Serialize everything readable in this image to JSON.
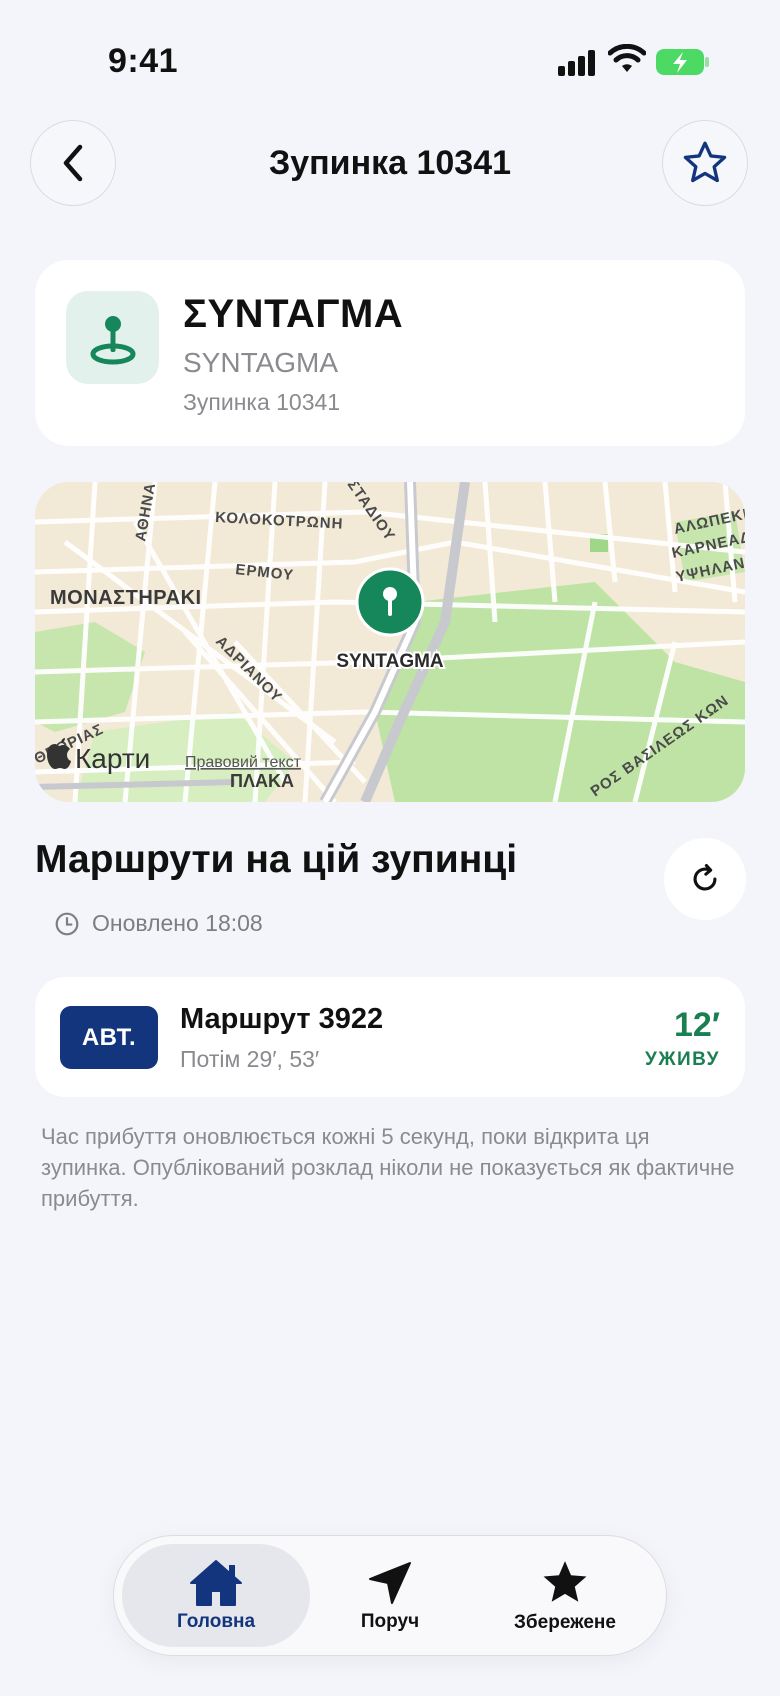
{
  "status_bar": {
    "time": "9:41"
  },
  "header": {
    "title": "Зупинка 10341"
  },
  "stop": {
    "name": "ΣΥΝΤΑΓΜΑ",
    "name_latin": "SYNTAGMA",
    "code_label": "Зупинка 10341"
  },
  "map": {
    "labels": {
      "kolokotroni": "ΚΟΛΟΚΟΤΡΩΝΗ",
      "ermou": "ΕΡΜΟΥ",
      "monastiraki": "ΜΟΝΑΣΤΗΡΑΚΙ",
      "adrianou": "ΑΔΡΙΑΝΟΥ",
      "athinas": "ΑΘΗΝΑ",
      "stadiou": "ΣΤΑΔΙΟΥ",
      "syntagma": "SYNTAGMA",
      "theorias": "ΘΕΩΡΙΑΣ",
      "plaka": "ΠΛΑΚΑ",
      "alopekis": "ΑΛΩΠΕΚΗ",
      "karneadou": "ΚΑΡΝΕΑΔ",
      "ypsilantou": "ΥΨΗΛΑΝ",
      "vasileos": "ΡΟΣ ΒΑΣΙΛΕΩΣ ΚΩΝ"
    },
    "attribution": "Карти",
    "legal": "Правовий текст"
  },
  "routes": {
    "title": "Маршрути на цій зупинці",
    "updated": "Оновлено 18:08",
    "items": [
      {
        "badge": "АВТ.",
        "name": "Маршрут 3922",
        "next": "Потім 29′, 53′",
        "eta": "12′",
        "eta_label": "УЖИВУ"
      }
    ],
    "note": "Час прибуття оновлюється кожні 5 секунд, поки відкрита ця зупинка. Опублікований розклад ніколи не показується як фактичне прибуття."
  },
  "tabs": {
    "home": "Головна",
    "nearby": "Поруч",
    "saved": "Збережене"
  },
  "colors": {
    "accent_blue": "#12357e",
    "live_green": "#1c7f52",
    "pin_green": "#16875a"
  }
}
